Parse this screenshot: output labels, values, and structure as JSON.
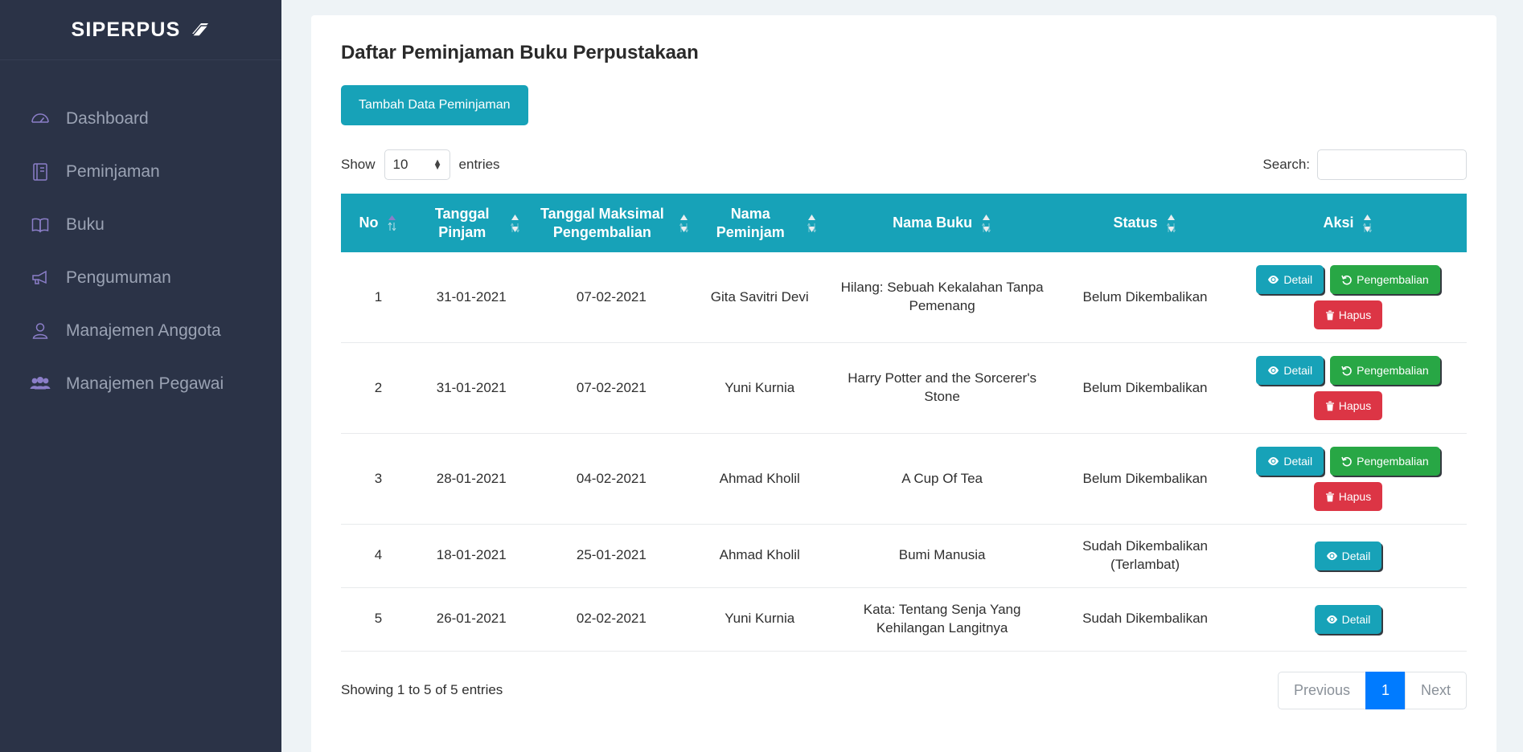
{
  "sidebar": {
    "brand": {
      "title": "SIPERPUS",
      "logo_icon": "book-stack-icon"
    },
    "items": [
      {
        "label": "Dashboard",
        "icon": "speedometer-icon"
      },
      {
        "label": "Peminjaman",
        "icon": "book-closed-icon"
      },
      {
        "label": "Buku",
        "icon": "book-open-icon"
      },
      {
        "label": "Pengumuman",
        "icon": "megaphone-icon"
      },
      {
        "label": "Manajemen Anggota",
        "icon": "user-icon"
      },
      {
        "label": "Manajemen Pegawai",
        "icon": "users-group-icon"
      }
    ]
  },
  "page": {
    "title": "Daftar Peminjaman Buku Perpustakaan",
    "add_button": "Tambah Data Peminjaman"
  },
  "controls": {
    "show_label": "Show",
    "entries_label": "entries",
    "page_length": "10",
    "search_label": "Search:",
    "search_value": "",
    "search_placeholder": ""
  },
  "table": {
    "columns": [
      "No",
      "Tanggal Pinjam",
      "Tanggal Maksimal Pengembalian",
      "Nama Peminjam",
      "Nama Buku",
      "Status",
      "Aksi"
    ],
    "rows": [
      {
        "no": "1",
        "tanggal_pinjam": "31-01-2021",
        "tanggal_maksimal": "07-02-2021",
        "nama_peminjam": "Gita Savitri Devi",
        "nama_buku": "Hilang: Sebuah Kekalahan Tanpa Pemenang",
        "status": "Belum Dikembalikan"
      },
      {
        "no": "2",
        "tanggal_pinjam": "31-01-2021",
        "tanggal_maksimal": "07-02-2021",
        "nama_peminjam": "Yuni Kurnia",
        "nama_buku": "Harry Potter and the Sorcerer's Stone",
        "status": "Belum Dikembalikan"
      },
      {
        "no": "3",
        "tanggal_pinjam": "28-01-2021",
        "tanggal_maksimal": "04-02-2021",
        "nama_peminjam": "Ahmad Kholil",
        "nama_buku": "A Cup Of Tea",
        "status": "Belum Dikembalikan"
      },
      {
        "no": "4",
        "tanggal_pinjam": "18-01-2021",
        "tanggal_maksimal": "25-01-2021",
        "nama_peminjam": "Ahmad Kholil",
        "nama_buku": "Bumi Manusia",
        "status": "Sudah Dikembalikan (Terlambat)"
      },
      {
        "no": "5",
        "tanggal_pinjam": "26-01-2021",
        "tanggal_maksimal": "02-02-2021",
        "nama_peminjam": "Yuni Kurnia",
        "nama_buku": "Kata: Tentang Senja Yang Kehilangan Langitnya",
        "status": "Sudah Dikembalikan"
      }
    ],
    "actions": {
      "detail": "Detail",
      "pengembalian": "Pengembalian",
      "hapus": "Hapus"
    }
  },
  "footer": {
    "info": "Showing 1 to 5 of 5 entries",
    "pagination": {
      "previous": "Previous",
      "current": "1",
      "next": "Next"
    }
  },
  "colors": {
    "sidebar_bg": "#2b3347",
    "accent_teal": "#17a2b8",
    "green": "#28a745",
    "red": "#dc3545",
    "active_page_blue": "#007bff",
    "page_bg": "#eef3f6",
    "icon_purple": "#8b7ec8"
  }
}
